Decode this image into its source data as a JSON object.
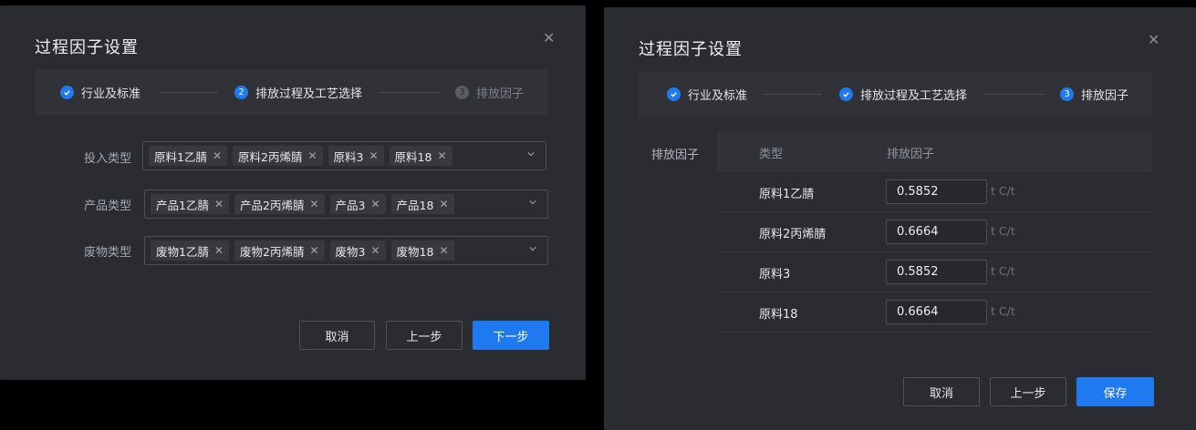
{
  "dialog_left": {
    "title": "过程因子设置",
    "close_glyph": "✕",
    "steps": [
      {
        "label": "行业及标准",
        "state": "done"
      },
      {
        "label": "排放过程及工艺选择",
        "state": "active",
        "num": "2"
      },
      {
        "label": "排放因子",
        "state": "inactive",
        "num": "3"
      }
    ],
    "fields": [
      {
        "label": "投入类型",
        "tags": [
          "原料1乙腈",
          "原料2丙烯腈",
          "原料3",
          "原料18"
        ]
      },
      {
        "label": "产品类型",
        "tags": [
          "产品1乙腈",
          "产品2丙烯腈",
          "产品3",
          "产品18"
        ]
      },
      {
        "label": "废物类型",
        "tags": [
          "废物1乙腈",
          "废物2丙烯腈",
          "废物3",
          "废物18"
        ]
      }
    ],
    "buttons": {
      "cancel": "取消",
      "prev": "上一步",
      "next": "下一步"
    }
  },
  "dialog_right": {
    "title": "过程因子设置",
    "close_glyph": "✕",
    "steps": [
      {
        "label": "行业及标准",
        "state": "done"
      },
      {
        "label": "排放过程及工艺选择",
        "state": "done"
      },
      {
        "label": "排放因子",
        "state": "active",
        "num": "3"
      }
    ],
    "section_label": "排放因子",
    "table_headers": {
      "type": "类型",
      "factor": "排放因子"
    },
    "rows": [
      {
        "material": "原料1乙腈",
        "value": "0.5852",
        "unit": "t C/t"
      },
      {
        "material": "原料2丙烯腈",
        "value": "0.6664",
        "unit": "t C/t"
      },
      {
        "material": "原料3",
        "value": "0.5852",
        "unit": "t C/t"
      },
      {
        "material": "原料18",
        "value": "0.6664",
        "unit": "t C/t"
      }
    ],
    "buttons": {
      "cancel": "取消",
      "prev": "上一步",
      "save": "保存"
    }
  },
  "colors": {
    "accent": "#1f7af0",
    "dialog_bg": "#2a2c31",
    "step_bar_bg": "#303238"
  },
  "icons": {
    "tag_remove": "close-icon",
    "select_arrow": "chevron-down-icon",
    "step_done": "check-circle-icon"
  }
}
